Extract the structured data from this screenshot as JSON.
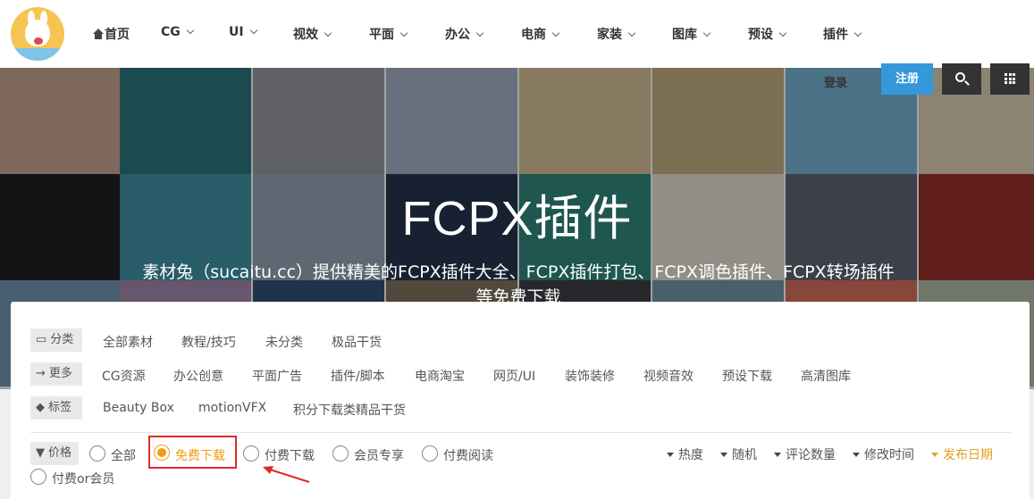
{
  "nav": {
    "home": "首页",
    "items": [
      "CG",
      "UI",
      "视效",
      "平面",
      "办公",
      "电商",
      "家装",
      "图库",
      "预设",
      "插件"
    ]
  },
  "header": {
    "login": "登录",
    "register": "注册"
  },
  "hero": {
    "title": "FCPX插件",
    "subtitle": "素材兔（sucaitu.cc）提供精美的FCPX插件大全、FCPX插件打包、FCPX调色插件、FCPX转场插件等免费下载"
  },
  "filters": {
    "category": {
      "label": "分类",
      "items": [
        "全部素材",
        "教程/技巧",
        "未分类",
        "极品干货"
      ]
    },
    "more": {
      "label": "更多",
      "items": [
        "CG资源",
        "办公创意",
        "平面广告",
        "插件/脚本",
        "电商淘宝",
        "网页/UI",
        "装饰装修",
        "视频音效",
        "预设下载",
        "高清图库"
      ]
    },
    "tags": {
      "label": "标签",
      "items": [
        "Beauty Box",
        "motionVFX",
        "积分下载类精品干货"
      ]
    },
    "price": {
      "label": "价格",
      "options": [
        "全部",
        "免费下载",
        "付费下载",
        "会员专享",
        "付费阅读",
        "付费or会员"
      ],
      "selected": "免费下载"
    }
  },
  "sort": [
    "热度",
    "随机",
    "评论数量",
    "修改时间",
    "发布日期"
  ],
  "sort_active": "发布日期",
  "colors": {
    "accent": "#f39c12",
    "register": "#3498db",
    "highlight": "#e0292a"
  }
}
